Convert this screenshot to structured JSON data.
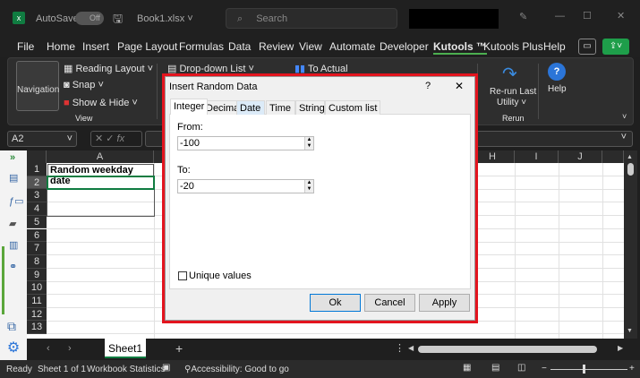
{
  "titlebar": {
    "autosave": "AutoSave",
    "toggle": "Off",
    "filename": "Book1.xlsx ˅",
    "search_placeholder": "Search"
  },
  "menu": [
    "File",
    "Home",
    "Insert",
    "Page Layout",
    "Formulas",
    "Data",
    "Review",
    "View",
    "Automate",
    "Developer",
    "Kutools ™",
    "Kutools Plus",
    "Help"
  ],
  "ribbon": {
    "navigation": "Navigation",
    "reading_layout": "Reading Layout",
    "snap": "Snap",
    "show_hide": "Show & Hide",
    "group_view": "View",
    "dropdown_list": "Drop-down List",
    "to_actual": "To Actual",
    "rerun": "Re-run Last",
    "utility": "Utility",
    "group_rerun": "Rerun",
    "help": "Help"
  },
  "formula": {
    "namebox": "A2",
    "fx": "fx"
  },
  "grid": {
    "columns": [
      "A",
      "H",
      "I",
      "J"
    ],
    "rows": [
      "1",
      "2",
      "3",
      "4",
      "5",
      "6",
      "7",
      "8",
      "9",
      "10",
      "11",
      "12",
      "13"
    ],
    "a1": "Random weekday date"
  },
  "dialog": {
    "title": "Insert Random Data",
    "help": "?",
    "close": "✕",
    "tabs": [
      "Integer",
      "Decimal",
      "Date",
      "Time",
      "String",
      "Custom list"
    ],
    "from_label": "From:",
    "from_value": "-100",
    "to_label": "To:",
    "to_value": "-20",
    "unique": "Unique values",
    "ok": "Ok",
    "cancel": "Cancel",
    "apply": "Apply"
  },
  "sheettabs": {
    "active": "Sheet1",
    "add": "+"
  },
  "status": {
    "ready": "Ready",
    "sheet": "Sheet 1 of 1",
    "stats": "Workbook Statistics",
    "accessibility": "Accessibility: Good to go"
  },
  "colors": {
    "excel_green": "#107c41",
    "highlight_red": "#e3141e"
  }
}
